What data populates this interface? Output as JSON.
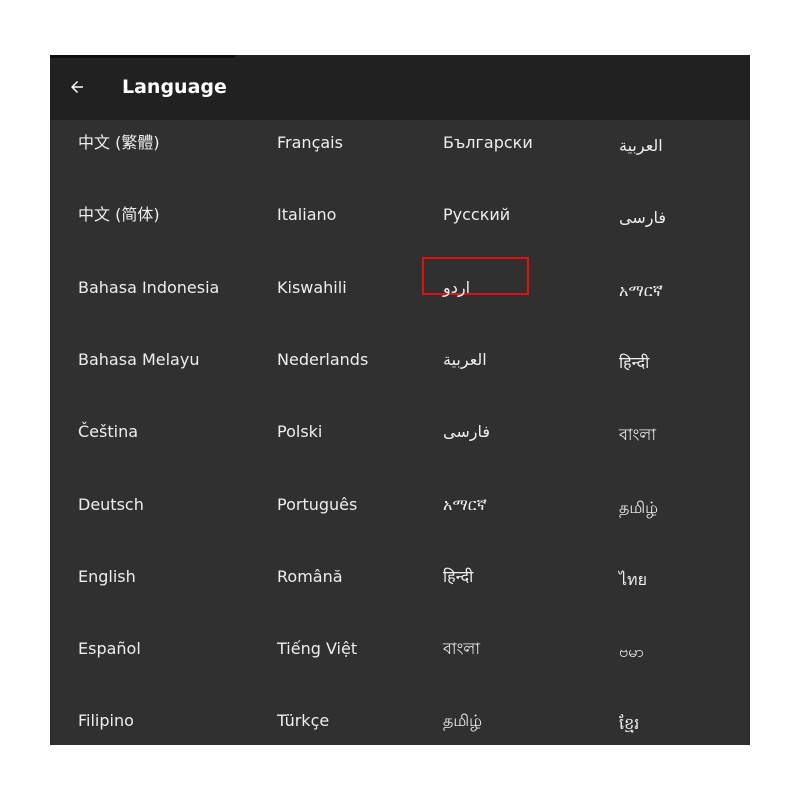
{
  "header": {
    "title": "Language",
    "back_icon": "arrow-left-icon"
  },
  "languages": [
    [
      "中文 (繁體)",
      "Français",
      "Български",
      "العربية"
    ],
    [
      "中文 (简体)",
      "Italiano",
      "Русский",
      "فارسی"
    ],
    [
      "Bahasa Indonesia",
      "Kiswahili",
      "اردو",
      "አማርኛ"
    ],
    [
      "Bahasa Melayu",
      "Nederlands",
      "العربية",
      "हिन्दी"
    ],
    [
      "Čeština",
      "Polski",
      "فارسی",
      "বাংলা"
    ],
    [
      "Deutsch",
      "Português",
      "አማርኛ",
      "தமிழ்"
    ],
    [
      "English",
      "Română",
      "हिन्दी",
      "ไทย"
    ],
    [
      "Español",
      "Tiếng Việt",
      "বাংলা",
      "ဗမာ"
    ],
    [
      "Filipino",
      "Türkçe",
      "தமிழ்",
      "ខ្មែរ"
    ]
  ],
  "highlighted": "Русский",
  "colors": {
    "app_bar": "#212121",
    "background": "#303030",
    "text": "#eeeeee",
    "highlight_border": "#e01010"
  }
}
